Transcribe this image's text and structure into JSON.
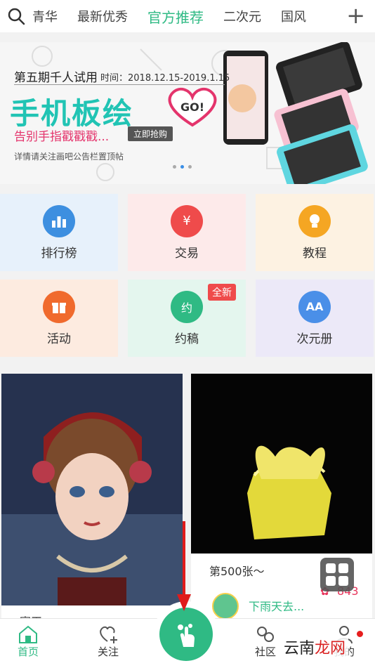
{
  "top_tabs": [
    "青华",
    "最新优秀",
    "官方推荐",
    "二次元",
    "国风"
  ],
  "banner": {
    "issue": "第五期千人试用",
    "time": "时间：2018.12.15-2019.1.15",
    "headline": "手机板绘",
    "go": "GO!",
    "slogan": "告别手指戳戳戳...",
    "cta": "立即抢购",
    "note": "详情请关注画吧公告栏置顶帖"
  },
  "grid": [
    {
      "label": "排行榜",
      "icon": "ranking-icon",
      "color": "#3d8fe0"
    },
    {
      "label": "交易",
      "icon": "trade-icon",
      "color": "#ef4b4b"
    },
    {
      "label": "教程",
      "icon": "bulb-icon",
      "color": "#f5a623"
    },
    {
      "label": "活动",
      "icon": "gift-icon",
      "color": "#f06a2d"
    },
    {
      "label": "约稿",
      "icon": "commission-icon",
      "color": "#2fba84",
      "badge": "全新"
    },
    {
      "label": "次元册",
      "icon": "album-icon",
      "color": "#4a8fe8"
    }
  ],
  "cards": [
    {
      "caption": "寒玉"
    },
    {
      "caption": "第500张～",
      "author": "下雨天去...",
      "likes": "843"
    }
  ],
  "bottom_nav": [
    "首页",
    "关注",
    "社区",
    "我的"
  ],
  "watermark": {
    "a": "云南",
    "b": "龙网"
  }
}
